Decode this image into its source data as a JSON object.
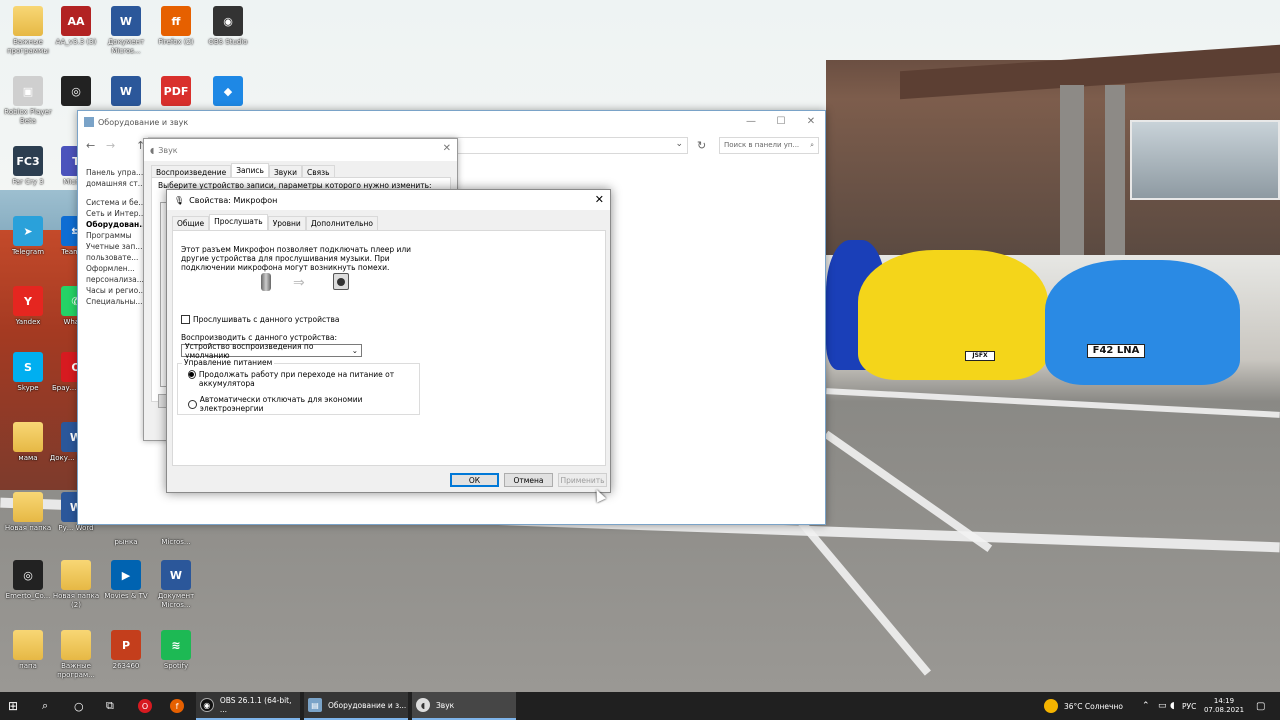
{
  "desktop": {
    "icons": [
      {
        "label": "Важные программы",
        "glyph": "",
        "kind": "folder"
      },
      {
        "label": "AA_v3.3 (3)",
        "glyph": "AA",
        "kind": "app",
        "color": "#b22222"
      },
      {
        "label": "Документ Micros...",
        "glyph": "W",
        "kind": "word"
      },
      {
        "label": "Firefox (2)",
        "glyph": "ff",
        "kind": "app",
        "color": "#e66000"
      },
      {
        "label": "OBS Studio",
        "glyph": "◉",
        "kind": "app",
        "color": "#333333"
      },
      {
        "label": "Roblox Player Beta",
        "glyph": "▣",
        "kind": "app",
        "color": "#cfcfcf"
      },
      {
        "label": "",
        "glyph": "◎",
        "kind": "app",
        "color": "#222222"
      },
      {
        "label": "",
        "glyph": "W",
        "kind": "word"
      },
      {
        "label": "",
        "glyph": "PDF",
        "kind": "app",
        "color": "#d9302c"
      },
      {
        "label": "",
        "glyph": "◆",
        "kind": "app",
        "color": "#1e88e5"
      },
      {
        "label": "Far Cry 3",
        "glyph": "FC3",
        "kind": "app",
        "color": "#2c3e50"
      },
      {
        "label": "Micro...",
        "glyph": "T",
        "kind": "app",
        "color": "#4b53bc"
      },
      {
        "label": "Telegram",
        "glyph": "➤",
        "kind": "app",
        "color": "#2aa1da"
      },
      {
        "label": "TeamV...",
        "glyph": "⇆",
        "kind": "app",
        "color": "#0e6dd3"
      },
      {
        "label": "Yandex",
        "glyph": "Y",
        "kind": "app",
        "color": "#e52620"
      },
      {
        "label": "What...",
        "glyph": "✆",
        "kind": "app",
        "color": "#25d366"
      },
      {
        "label": "Skype",
        "glyph": "S",
        "kind": "app",
        "color": "#00aff0"
      },
      {
        "label": "Брау... Opera",
        "glyph": "O",
        "kind": "app",
        "color": "#d71a20"
      },
      {
        "label": "мама",
        "glyph": "",
        "kind": "folder"
      },
      {
        "label": "Доку... Micro...",
        "glyph": "W",
        "kind": "word"
      },
      {
        "label": "Новая папка",
        "glyph": "",
        "kind": "folder"
      },
      {
        "label": "Ру... Word",
        "glyph": "W",
        "kind": "word"
      },
      {
        "label": "рынка",
        "glyph": "",
        "kind": "none"
      },
      {
        "label": "Micros...",
        "glyph": "",
        "kind": "none"
      },
      {
        "label": "Emerto_Co...",
        "glyph": "◎",
        "kind": "app",
        "color": "#222222"
      },
      {
        "label": "Новая папка (2)",
        "glyph": "",
        "kind": "folder"
      },
      {
        "label": "Movies & TV",
        "glyph": "▶",
        "kind": "app",
        "color": "#0063b1"
      },
      {
        "label": "Документ Micros...",
        "glyph": "W",
        "kind": "word"
      },
      {
        "label": "папа",
        "glyph": "",
        "kind": "folder"
      },
      {
        "label": "Важные програм...",
        "glyph": "",
        "kind": "folder"
      },
      {
        "label": "263460",
        "glyph": "P",
        "kind": "app",
        "color": "#c43e1c"
      },
      {
        "label": "Spotify",
        "glyph": "≋",
        "kind": "app",
        "color": "#1db954"
      }
    ],
    "plates": [
      "F42 LNA",
      "JSFX"
    ]
  },
  "explorer": {
    "title": "Оборудование и звук",
    "search_placeholder": "Поиск в панели уп...",
    "sidebar": [
      "Панель упра...",
      "домашняя ст...",
      "Система и бе...",
      "Сеть и Интер...",
      "Оборудован...",
      "Программы",
      "Учетные зап...",
      "пользовате...",
      "Оформлен...",
      "персонализа...",
      "Часы и регио...",
      "Специальны..."
    ]
  },
  "sound": {
    "title": "Звук",
    "tabs": [
      "Воспроизведение",
      "Запись",
      "Звуки",
      "Связь"
    ],
    "active_tab": 1,
    "prompt": "Выберите устройство записи, параметры которого нужно изменить:"
  },
  "mic_props": {
    "title": "Свойства: Микрофон",
    "tabs": [
      "Общие",
      "Прослушать",
      "Уровни",
      "Дополнительно"
    ],
    "active_tab": 1,
    "description": "Этот разъем Микрофон позволяет подключать плеер или другие устройства для прослушивания музыки. При подключении микрофона могут возникнуть помехи.",
    "listen_checkbox_label": "Прослушивать с данного устройства",
    "listen_checked": false,
    "playback_label": "Воспроизводить с данного устройства:",
    "playback_value": "Устройство воспроизведения по умолчанию",
    "power_group_title": "Управление питанием",
    "power_option_1": "Продолжать работу при переходе на питание от аккумулятора",
    "power_option_2": "Автоматически отключать для экономии электроэнергии",
    "power_selected": 1,
    "ok": "ОК",
    "cancel": "Отмена",
    "apply": "Применить"
  },
  "taskbar": {
    "apps": [
      {
        "label": "OBS 26.1.1 (64-bit, ..."
      },
      {
        "label": "Оборудование и з..."
      },
      {
        "label": "Звук"
      }
    ],
    "weather": "36°C Солнечно",
    "language": "РУС",
    "time": "14:19",
    "date": "07.08.2021"
  }
}
